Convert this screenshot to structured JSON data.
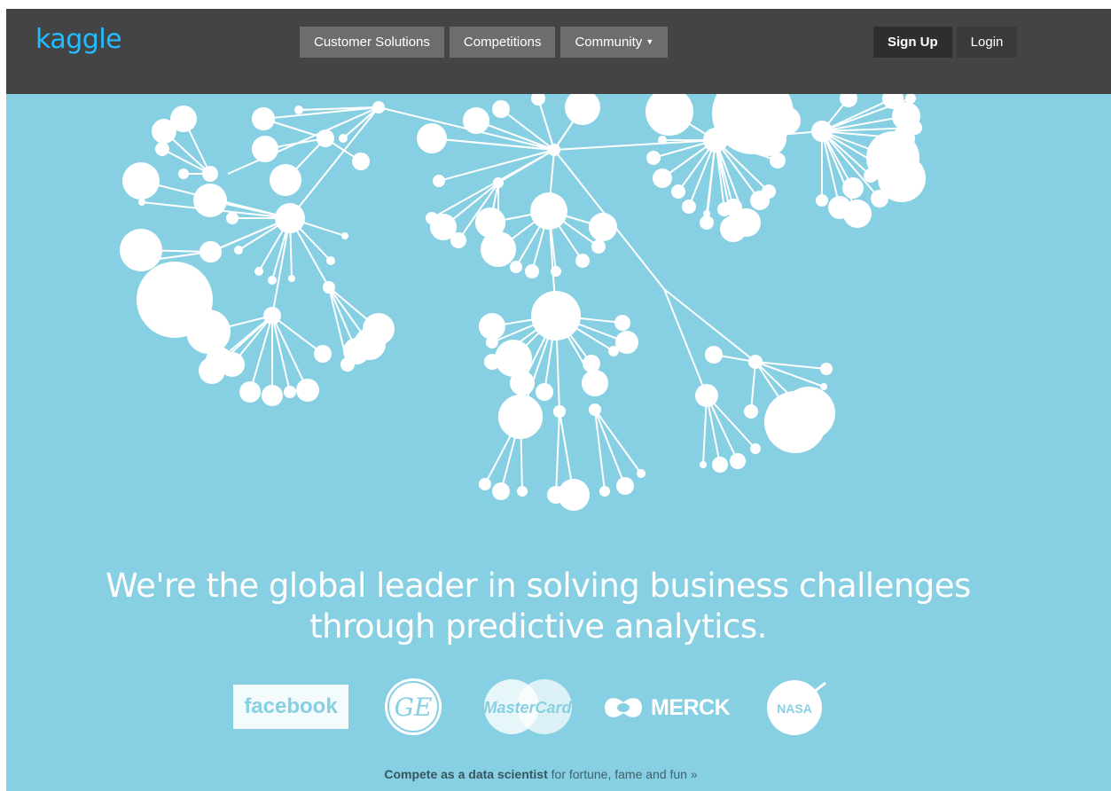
{
  "header": {
    "logo_text": "kaggle",
    "nav": [
      {
        "label": "Customer Solutions"
      },
      {
        "label": "Competitions"
      },
      {
        "label": "Community"
      }
    ],
    "signup_label": "Sign Up",
    "login_label": "Login"
  },
  "hero": {
    "headline_line1": "We're the global leader in solving business challenges",
    "headline_line2": "through predictive analytics."
  },
  "logos": {
    "facebook": "facebook",
    "ge": "GE",
    "mastercard": "MasterCard",
    "merck": "MERCK",
    "nasa": "NASA"
  },
  "cta": {
    "strong": "Compete as a data scientist",
    "rest": " for fortune, fame and fun »"
  },
  "colors": {
    "hero_bg": "#87cfe2",
    "topbar_bg": "#444444",
    "logo": "#20beff",
    "nav_bg": "#6d6d6d"
  },
  "icons": [
    "caret-down-icon",
    "network-graphic"
  ]
}
